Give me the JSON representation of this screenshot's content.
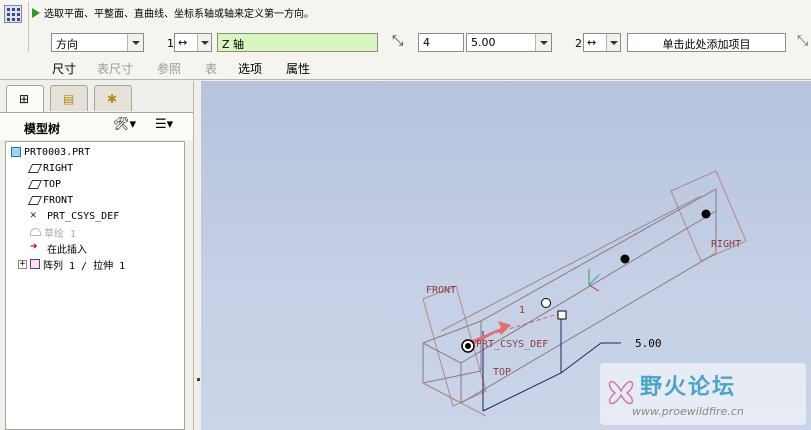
{
  "dashboard": {
    "prompt": "选取平面、平整面、直曲线、坐标系轴或轴来定义第一方向。",
    "direction_type": "方向",
    "first_direction": {
      "index": "1",
      "flip_symbol": "↔",
      "reference": "Z 轴",
      "count": "4",
      "spacing": "5.00"
    },
    "second_direction": {
      "index": "2",
      "flip_symbol": "↔",
      "add_item": "单击此处添加项目"
    },
    "tabs": [
      "尺寸",
      "表尺寸",
      "参照",
      "表",
      "选项",
      "属性"
    ]
  },
  "model_tree": {
    "title": "模型树",
    "items": [
      {
        "label": "PRT0003.PRT",
        "icon": "part-icon"
      },
      {
        "label": "RIGHT",
        "icon": "datum-plane-icon"
      },
      {
        "label": "TOP",
        "icon": "datum-plane-icon"
      },
      {
        "label": "FRONT",
        "icon": "datum-plane-icon"
      },
      {
        "label": "PRT_CSYS_DEF",
        "icon": "csys-icon"
      },
      {
        "label": "草绘 1",
        "icon": "sketch-icon"
      },
      {
        "label": "在此插入",
        "icon": "insert-here-icon"
      },
      {
        "label": "阵列 1 / 拉伸 1",
        "icon": "pattern-icon"
      }
    ]
  },
  "graphics": {
    "plane_labels": [
      "FRONT",
      "RIGHT",
      "TOP"
    ],
    "csys_label": "PRT_CSYS_DEF",
    "dim_value": "5.00",
    "axis_label": "1"
  },
  "watermark": {
    "title": "野火论坛",
    "url": "www.proewildfire.cn"
  },
  "colors": {
    "reference_bg": "#d9f5c0",
    "prompt_arrow": "#2a9a2a",
    "insert_arrow": "#c20000"
  }
}
